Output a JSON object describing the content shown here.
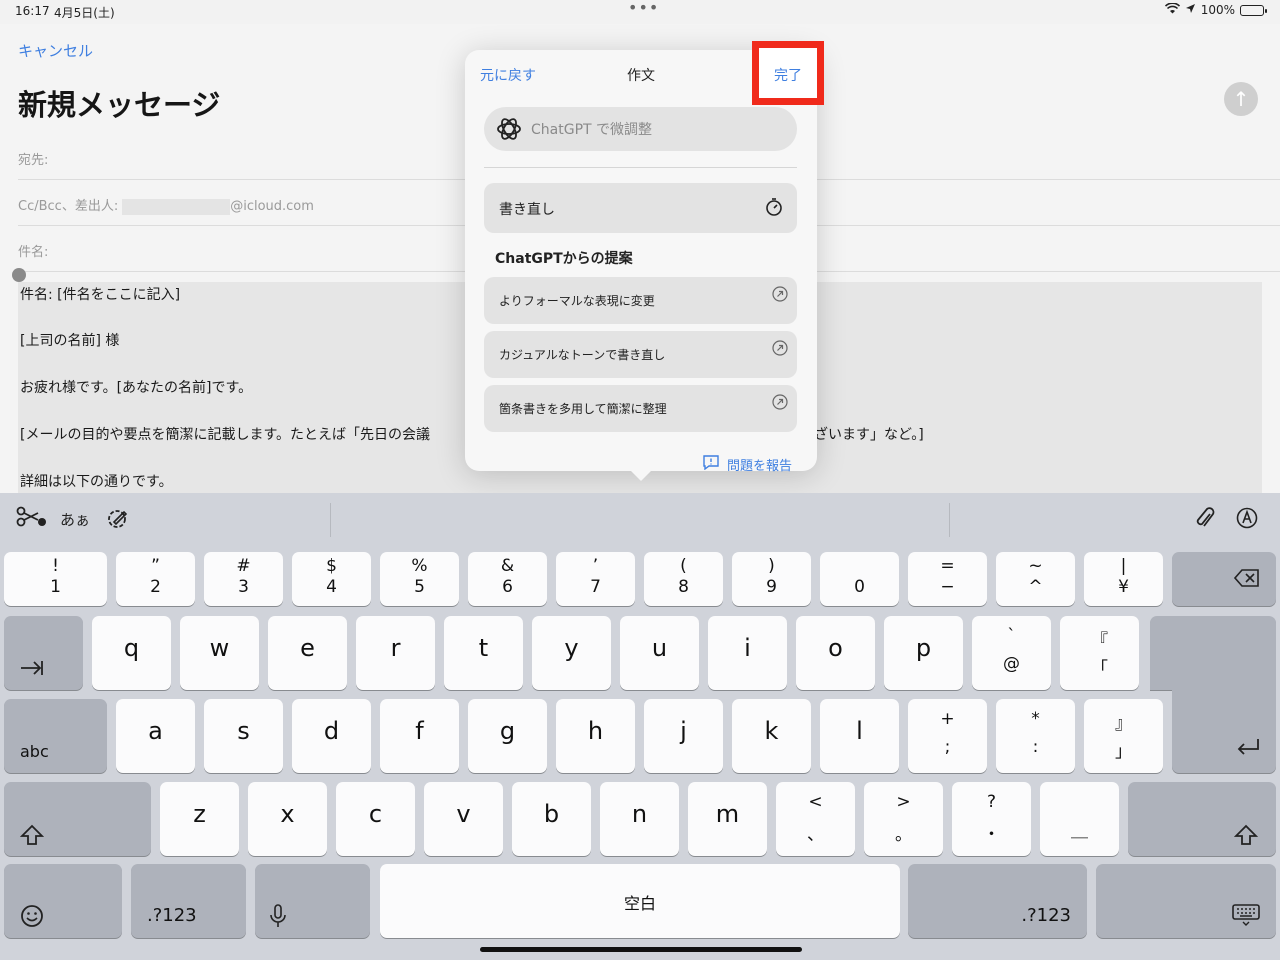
{
  "status": {
    "time": "16:17",
    "date": "4月5日(土)",
    "battery": "100%"
  },
  "compose": {
    "cancel": "キャンセル",
    "title": "新規メッセージ",
    "to_label": "宛先:",
    "cc_label": "Cc/Bcc、差出人:",
    "from_suffix": "@icloud.com",
    "subject_label": "件名:",
    "body_lines": [
      "件名: [件名をここに記入]",
      "[上司の名前] 様",
      "お疲れ様です。[あなたの名前]です。",
      "[メールの目的や要点を簡潔に記載します。たとえば「先日の会議",
      "ざいます」など。]",
      "詳細は以下の通りです。"
    ]
  },
  "popover": {
    "back": "元に戻す",
    "title": "作文",
    "done": "完了",
    "gpt_placeholder": "ChatGPT で微調整",
    "rewrite": "書き直し",
    "suggest_header": "ChatGPTからの提案",
    "suggestions": [
      "よりフォーマルな表現に変更",
      "カジュアルなトーンで書き直し",
      "箇条書きを多用して簡潔に整理"
    ],
    "report": "問題を報告"
  },
  "keyboard": {
    "toolbar_kana": "あぁ",
    "number_row": [
      {
        "top": "!",
        "bot": "1"
      },
      {
        "top": "”",
        "bot": "2"
      },
      {
        "top": "#",
        "bot": "3"
      },
      {
        "top": "$",
        "bot": "4"
      },
      {
        "top": "%",
        "bot": "5"
      },
      {
        "top": "&",
        "bot": "6"
      },
      {
        "top": "’",
        "bot": "7"
      },
      {
        "top": "(",
        "bot": "8"
      },
      {
        "top": ")",
        "bot": "9"
      },
      {
        "top": "",
        "bot": "0"
      },
      {
        "top": "=",
        "bot": "−"
      },
      {
        "top": "~",
        "bot": "^"
      },
      {
        "top": "|",
        "bot": "¥"
      }
    ],
    "row_q": [
      "q",
      "w",
      "e",
      "r",
      "t",
      "y",
      "u",
      "i",
      "o",
      "p"
    ],
    "row_q_extra": [
      {
        "top": "`",
        "bot": "@"
      },
      {
        "top": "『",
        "bot": "「"
      }
    ],
    "row_a": [
      "a",
      "s",
      "d",
      "f",
      "g",
      "h",
      "j",
      "k",
      "l"
    ],
    "row_a_extra": [
      {
        "top": "+",
        "bot": ";"
      },
      {
        "top": "*",
        "bot": ":"
      },
      {
        "top": "』",
        "bot": "」"
      }
    ],
    "row_z": [
      "z",
      "x",
      "c",
      "v",
      "b",
      "n",
      "m"
    ],
    "row_z_extra": [
      {
        "top": "<",
        "bot": "、"
      },
      {
        "top": ">",
        "bot": "。"
      },
      {
        "top": "?",
        "bot": "・"
      },
      {
        "top": "",
        "bot": "＿"
      }
    ],
    "abc": "abc",
    "num_left": ".?123",
    "num_right": ".?123",
    "space": "空白"
  }
}
